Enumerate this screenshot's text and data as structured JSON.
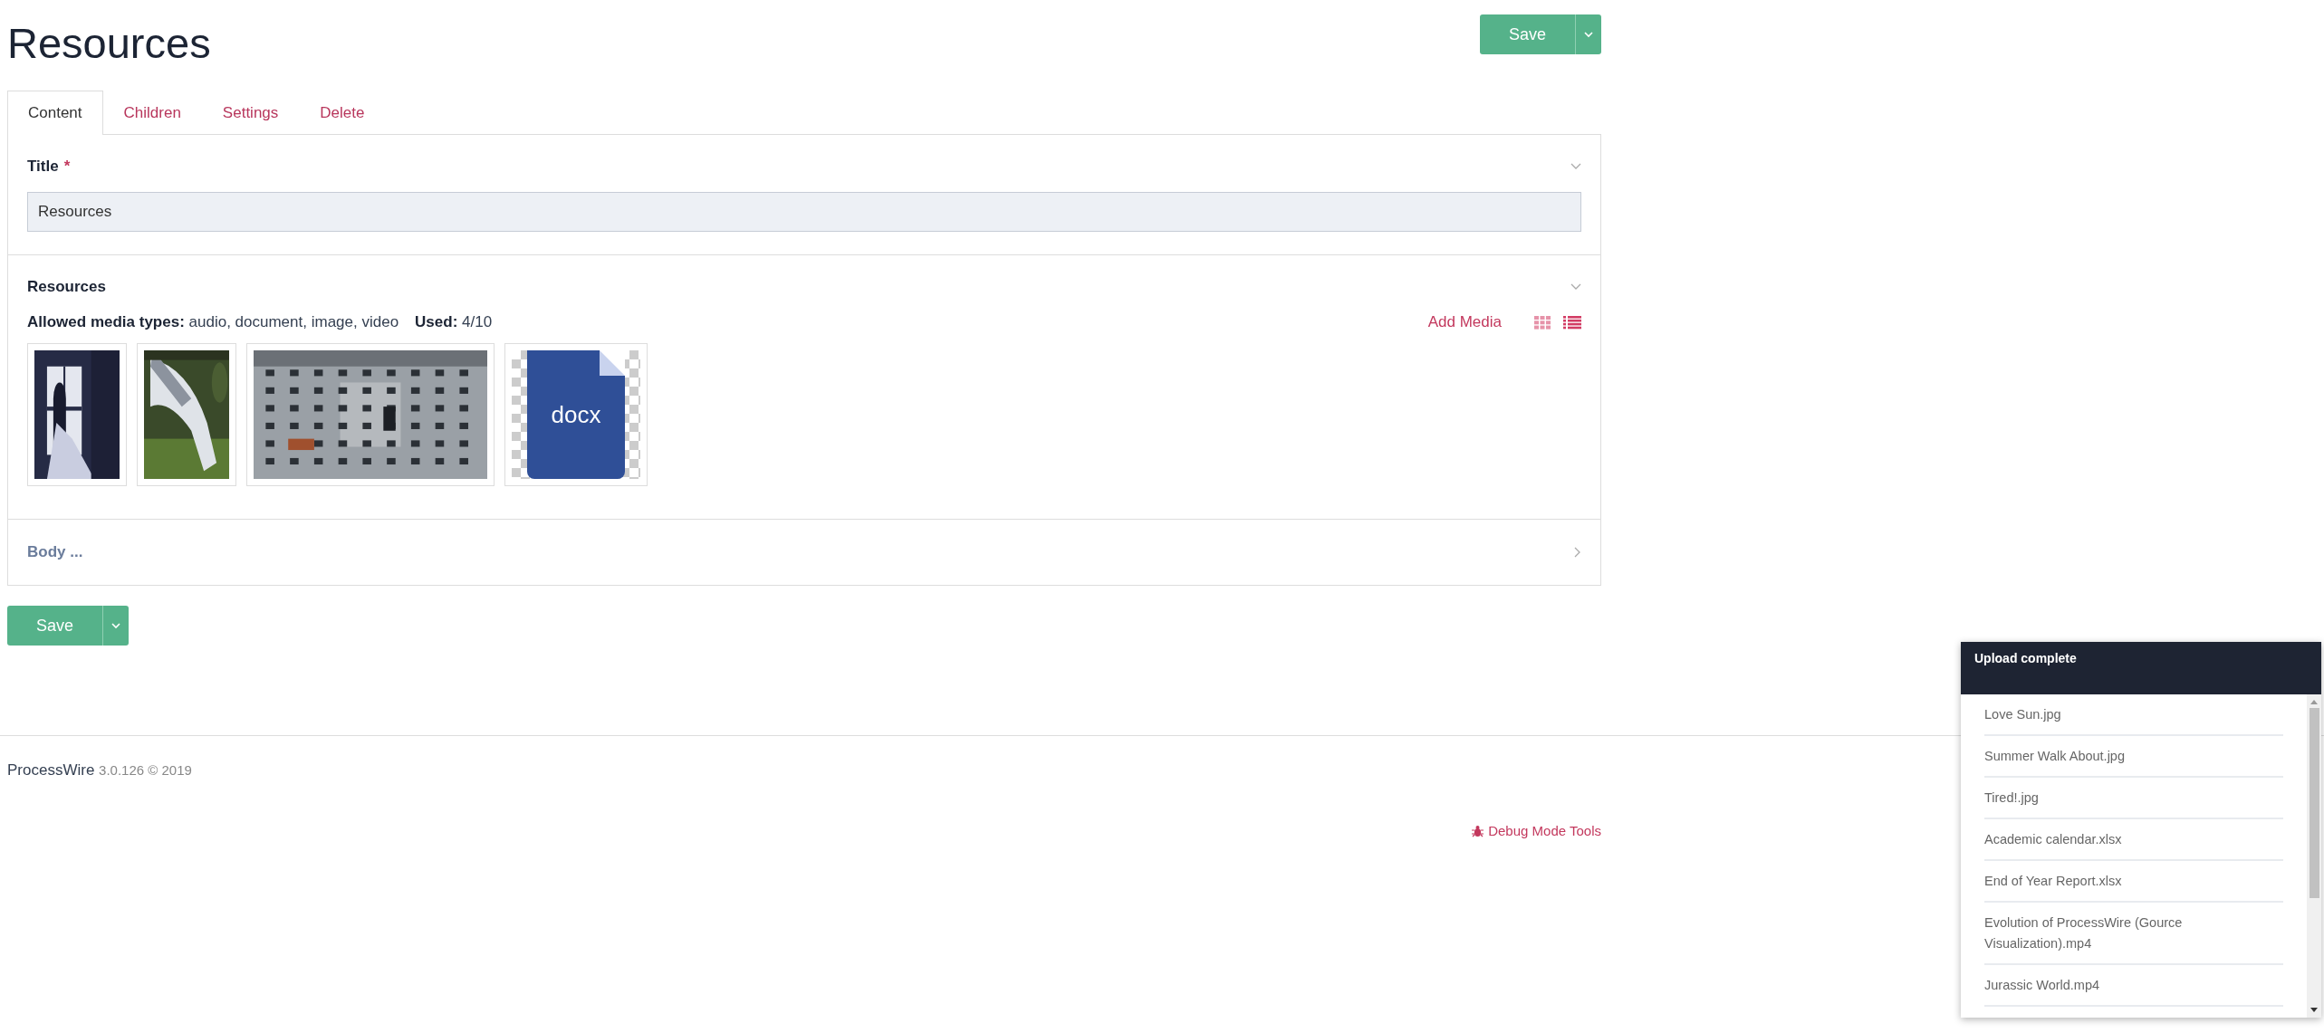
{
  "page": {
    "title": "Resources"
  },
  "save_buttons": [
    {
      "label": "Save"
    },
    {
      "label": "Save"
    }
  ],
  "tabs": [
    {
      "label": "Content",
      "selected": true
    },
    {
      "label": "Children",
      "selected": false
    },
    {
      "label": "Settings",
      "selected": false
    },
    {
      "label": "Delete",
      "selected": false
    }
  ],
  "fields": [
    {
      "kind": "text",
      "label": "Title",
      "required_mark": "*",
      "expanded": true,
      "value": "Resources"
    },
    {
      "kind": "media",
      "label": "Resources",
      "expanded": true,
      "allowed_label": "Allowed media types:",
      "allowed_value": "audio, document, image, video",
      "used_label": "Used:",
      "used_value": "4/10",
      "add_link": "Add Media",
      "view_modes": [
        {
          "kind": "grid",
          "selected": false
        },
        {
          "kind": "list",
          "selected": true
        }
      ],
      "items": [
        {
          "kind": "picture"
        },
        {
          "kind": "picture"
        },
        {
          "kind": "picture"
        },
        {
          "kind": "file",
          "label": "docx"
        }
      ]
    },
    {
      "label": "Body ...",
      "expanded": false
    }
  ],
  "footer": {
    "brand": "ProcessWire",
    "version": "3.0.126 © 2019",
    "debug_link": "Debug Mode Tools"
  },
  "upload_panel": {
    "title": "Upload complete",
    "files": [
      "Love Sun.jpg",
      "Summer Walk About.jpg",
      "Tired!.jpg",
      "Academic calendar.xlsx",
      "End of Year Report.xlsx",
      "Evolution of ProcessWire (Gource Visualization).mp4",
      "Jurassic World.mp4"
    ]
  }
}
